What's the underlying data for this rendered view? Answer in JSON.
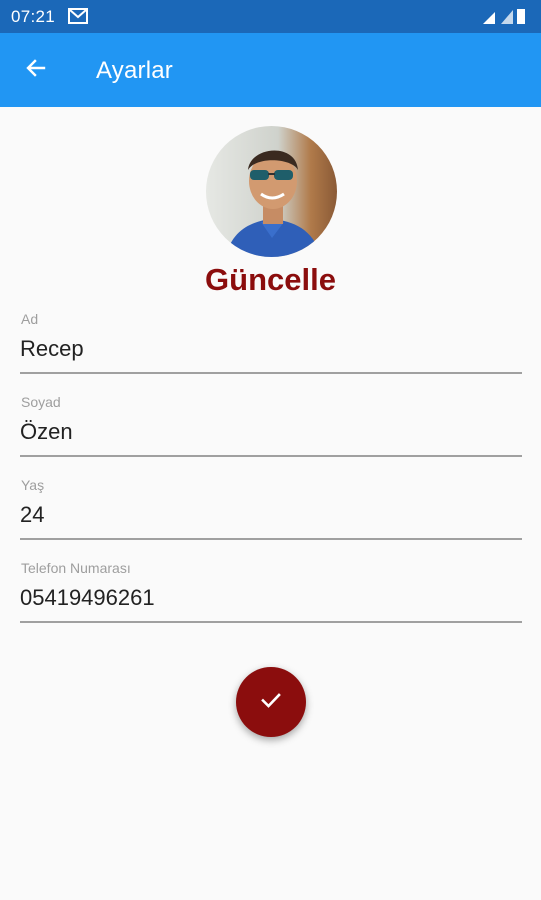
{
  "status_bar": {
    "time": "07:21"
  },
  "app_bar": {
    "title": "Ayarlar"
  },
  "profile": {
    "update_label": "Güncelle"
  },
  "form": {
    "fields": [
      {
        "label": "Ad",
        "value": "Recep"
      },
      {
        "label": "Soyad",
        "value": "Özen"
      },
      {
        "label": "Yaş",
        "value": "24"
      },
      {
        "label": "Telefon Numarası",
        "value": "05419496261"
      }
    ]
  },
  "colors": {
    "status_bar": "#1b68b8",
    "app_bar": "#2196f3",
    "accent": "#8b0d0d",
    "background": "#fafafa"
  },
  "icons": {
    "back": "arrow-left-icon",
    "confirm": "check-icon",
    "notification": "mail-icon"
  }
}
